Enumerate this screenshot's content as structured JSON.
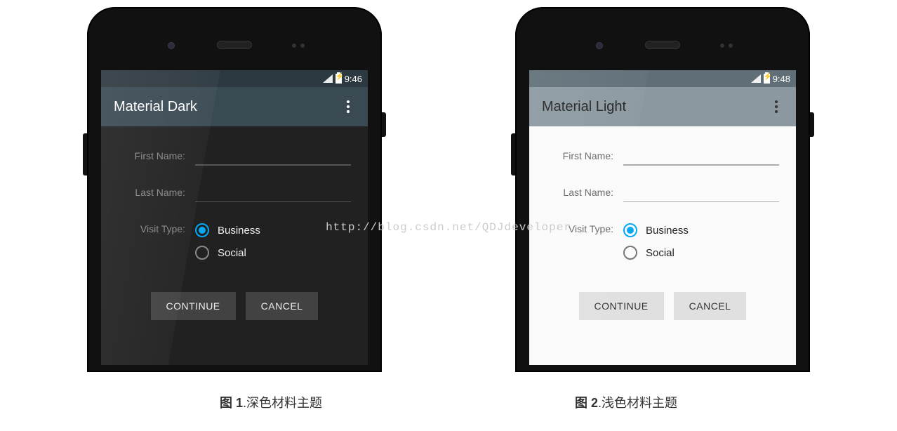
{
  "watermark": "http://blog.csdn.net/QDJdeveloper",
  "phones": {
    "dark": {
      "statusbar": {
        "time": "9:46"
      },
      "appbar": {
        "title": "Material Dark"
      },
      "form": {
        "first_name_label": "First Name:",
        "last_name_label": "Last Name:",
        "visit_type_label": "Visit Type:",
        "first_name_value": "",
        "last_name_value": "",
        "radio_business": "Business",
        "radio_social": "Social",
        "continue_label": "CONTINUE",
        "cancel_label": "CANCEL"
      }
    },
    "light": {
      "statusbar": {
        "time": "9:48"
      },
      "appbar": {
        "title": "Material Light"
      },
      "form": {
        "first_name_label": "First Name:",
        "last_name_label": "Last Name:",
        "visit_type_label": "Visit Type:",
        "first_name_value": "",
        "last_name_value": "",
        "radio_business": "Business",
        "radio_social": "Social",
        "continue_label": "CONTINUE",
        "cancel_label": "CANCEL"
      }
    }
  },
  "captions": {
    "fig1_prefix": "图 1",
    "fig1_text": ".深色材料主题",
    "fig2_prefix": "图 2",
    "fig2_text": ".浅色材料主题"
  }
}
